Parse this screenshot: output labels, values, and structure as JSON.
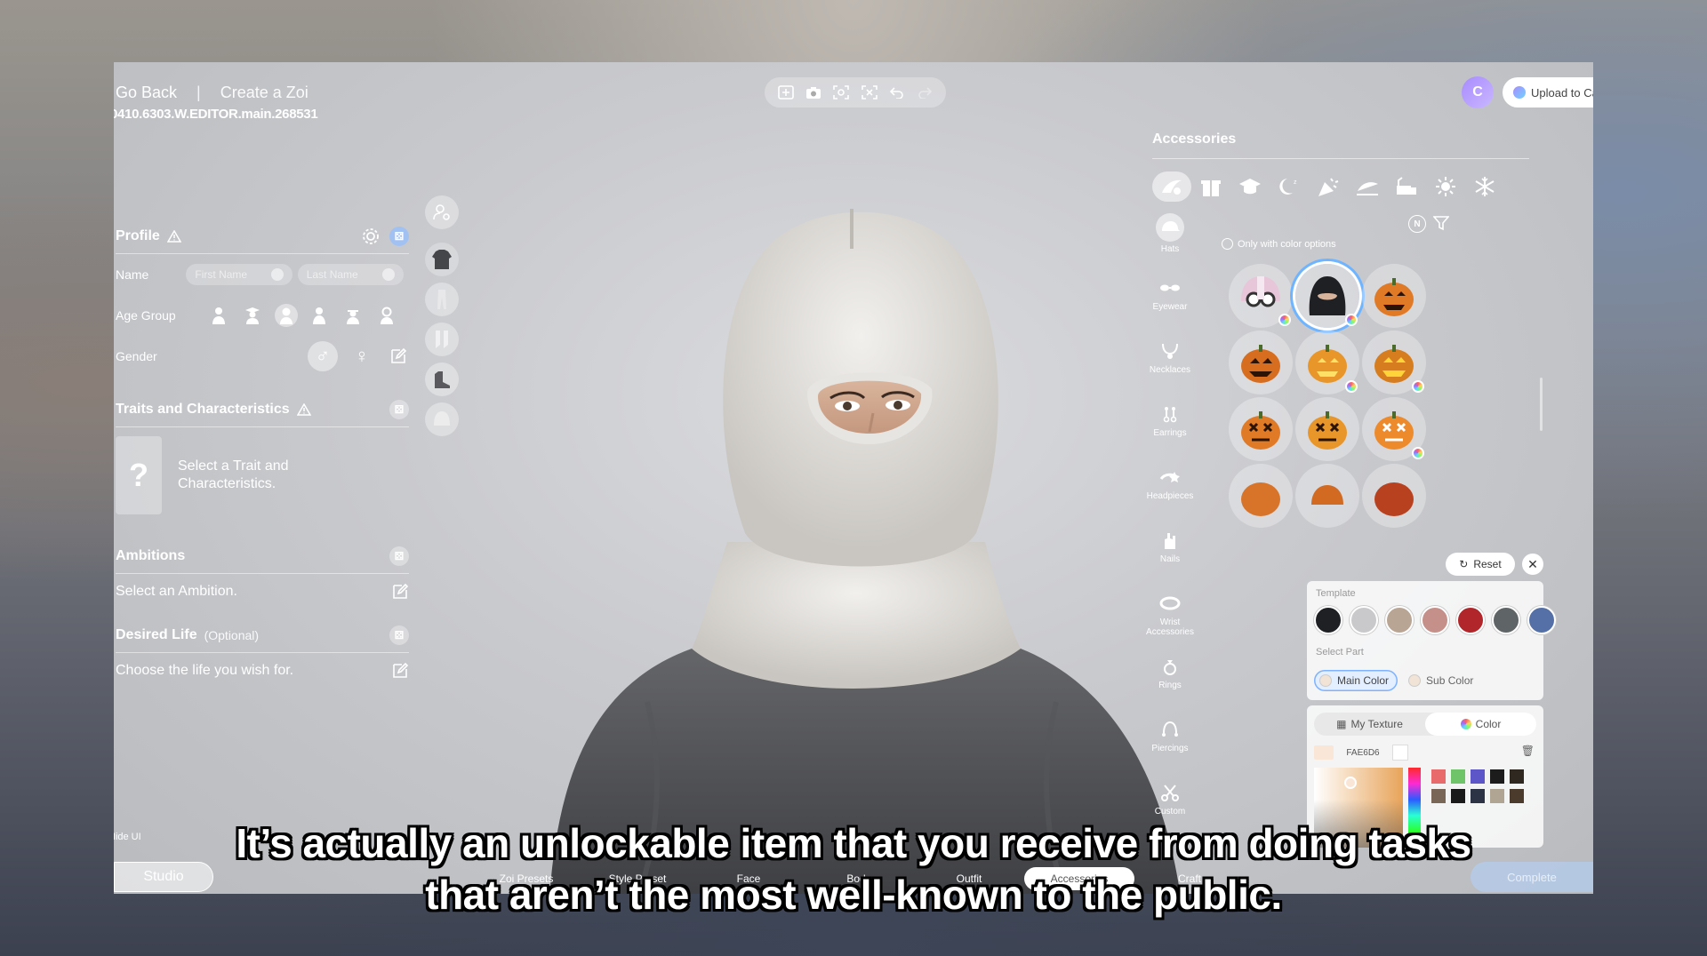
{
  "header": {
    "back_label": "Go Back",
    "separator": "|",
    "title": "Create a Zoi",
    "build": "0410.6303.W.EDITOR.main.268531"
  },
  "toolbar": [
    "add-frame-icon",
    "camera-icon",
    "fit-screen-icon",
    "focus-icon",
    "undo-icon",
    "redo-icon"
  ],
  "account": {
    "avatar_letter": "C",
    "upload_label": "Upload to Ca"
  },
  "profile": {
    "title": "Profile",
    "name_label": "Name",
    "first_name_placeholder": "First Name",
    "last_name_placeholder": "Last Name",
    "age_label": "Age Group",
    "gender_label": "Gender"
  },
  "traits": {
    "title": "Traits and Characteristics",
    "placeholder": "Select a Trait and Characteristics.",
    "question": "?"
  },
  "ambitions": {
    "title": "Ambitions",
    "placeholder": "Select an Ambition."
  },
  "desired_life": {
    "title": "Desired Life",
    "optional": "(Optional)",
    "placeholder": "Choose the life you wish for."
  },
  "accessories": {
    "title": "Accessories",
    "only_color_label": "Only with color options",
    "filter_n": "N",
    "categories": [
      {
        "label": "Hats",
        "icon": "hat-icon",
        "selected": true
      },
      {
        "label": "Eyewear",
        "icon": "glasses-icon",
        "selected": false
      },
      {
        "label": "Necklaces",
        "icon": "necklace-icon",
        "selected": false
      },
      {
        "label": "Earrings",
        "icon": "earring-icon",
        "selected": false
      },
      {
        "label": "Headpieces",
        "icon": "headpiece-icon",
        "selected": false
      },
      {
        "label": "Nails",
        "icon": "nail-icon",
        "selected": false
      },
      {
        "label": "Wrist Accessories",
        "icon": "wrist-icon",
        "selected": false
      },
      {
        "label": "Rings",
        "icon": "ring-icon",
        "selected": false
      },
      {
        "label": "Piercings",
        "icon": "piercing-icon",
        "selected": false
      },
      {
        "label": "Custom",
        "icon": "scissors-icon",
        "selected": false
      }
    ],
    "reset_label": "Reset"
  },
  "color_panel": {
    "template_label": "Template",
    "template_colors": [
      "#1e2024",
      "#c9c9cc",
      "#b8a594",
      "#c49089",
      "#b0262a",
      "#5f6466",
      "#5570a6"
    ],
    "select_part_label": "Select Part",
    "main_color_label": "Main Color",
    "sub_color_label": "Sub Color",
    "my_texture_label": "My Texture",
    "color_label": "Color",
    "hex_value": "FAE6D6",
    "palette": [
      "#e86a6a",
      "#6fc46a",
      "#5d56c9",
      "#1c1c1c",
      "#2e2820",
      "#7a6656",
      "#1a1a1a",
      "#2b3345",
      "#b0a592",
      "#4a3b2c"
    ]
  },
  "bottom": {
    "hide_ui": "Hide UI",
    "studio": "Studio",
    "nav": [
      "Zoi Presets",
      "Style Preset",
      "Face",
      "Body",
      "Outfit",
      "Accessories",
      "Craft"
    ],
    "complete": "Complete"
  },
  "subtitle": {
    "line1": "It’s actually an unlockable item that you receive from doing tasks",
    "line2": "that aren’t the most well-known to the public."
  }
}
